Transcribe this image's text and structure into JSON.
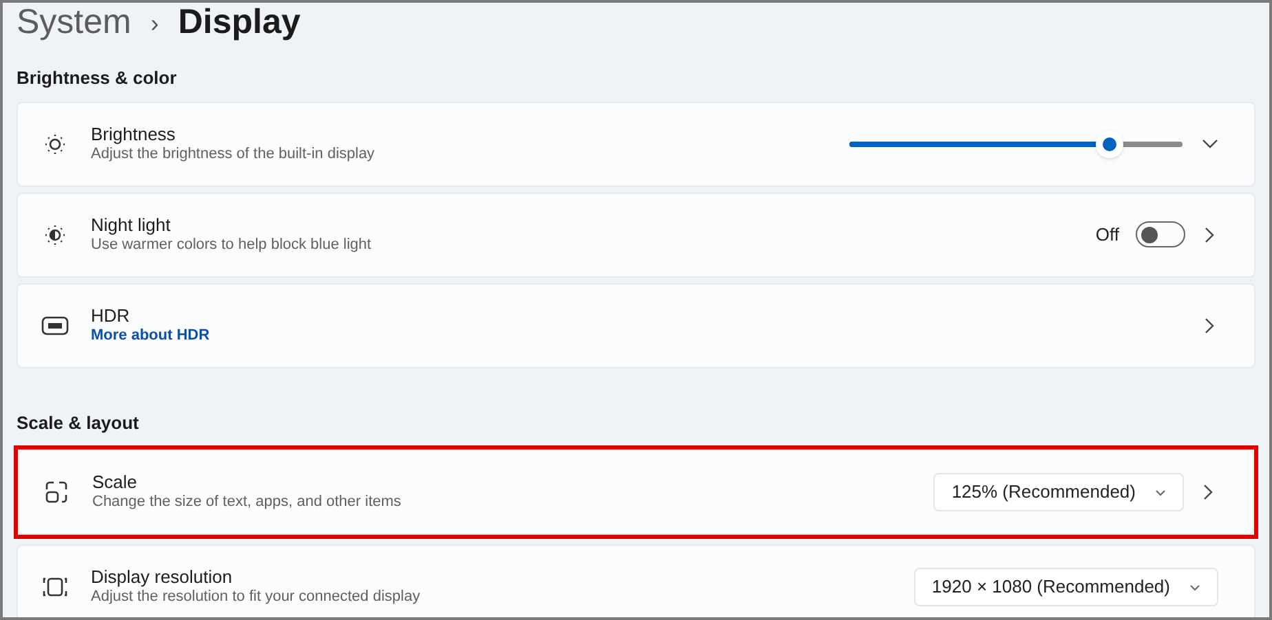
{
  "breadcrumb": {
    "parent": "System",
    "separator": "›",
    "current": "Display"
  },
  "sections": [
    {
      "heading": "Brightness & color",
      "items": [
        {
          "kind": "slider",
          "title": "Brightness",
          "subtitle": "Adjust the brightness of the built-in display",
          "level": 0.78,
          "expandable": true,
          "navigates": false,
          "highlighted": false
        },
        {
          "kind": "toggle",
          "title": "Night light",
          "subtitle": "Use warmer colors to help block blue light",
          "state_label": "Off",
          "on": false,
          "expandable": false,
          "navigates": true,
          "highlighted": false
        },
        {
          "kind": "link",
          "title": "HDR",
          "link": "More about HDR",
          "expandable": false,
          "navigates": true,
          "highlighted": false
        }
      ]
    },
    {
      "heading": "Scale & layout",
      "items": [
        {
          "kind": "dropdown",
          "title": "Scale",
          "subtitle": "Change the size of text, apps, and other items",
          "value": "125% (Recommended)",
          "expandable": false,
          "navigates": true,
          "highlighted": true
        },
        {
          "kind": "dropdown",
          "title": "Display resolution",
          "subtitle": "Adjust the resolution to fit your connected display",
          "value": "1920 × 1080 (Recommended)",
          "expandable": false,
          "navigates": false,
          "highlighted": false
        }
      ]
    }
  ]
}
